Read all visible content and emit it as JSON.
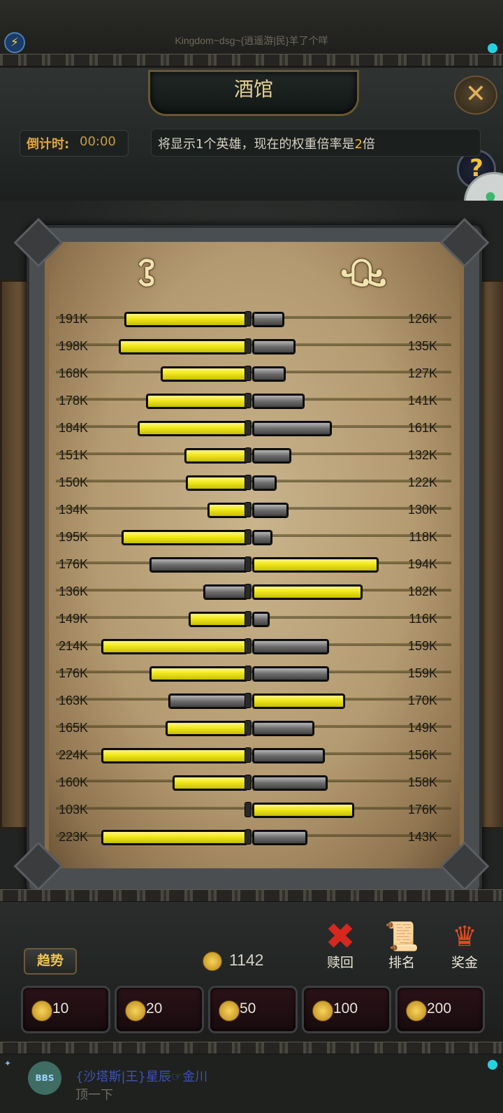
{
  "status": {
    "title": "Kingdom~dsg~{逍遥游|民}羊了个咩"
  },
  "header": {
    "title": "酒馆",
    "countdown_label": "倒计时:",
    "countdown_value": "00:00",
    "notice_prefix": "将显示1个英雄，现在的权重倍率是",
    "notice_multiplier": "2",
    "notice_suffix": "倍",
    "close_icon": "close-icon",
    "help_icon": "help-icon"
  },
  "chart_data": {
    "type": "bar",
    "series": [
      {
        "name": "",
        "values": [
          191,
          198,
          168,
          178,
          184,
          151,
          150,
          134,
          195,
          176,
          136,
          149,
          214,
          176,
          163,
          165,
          224,
          160,
          103,
          223
        ]
      },
      {
        "name": "",
        "values": [
          126,
          135,
          127,
          141,
          161,
          132,
          122,
          130,
          118,
          194,
          182,
          116,
          159,
          159,
          170,
          149,
          156,
          158,
          176,
          143
        ]
      }
    ],
    "left_labels": [
      "191K",
      "198K",
      "168K",
      "178K",
      "184K",
      "151K",
      "150K",
      "134K",
      "195K",
      "176K",
      "136K",
      "149K",
      "214K",
      "176K",
      "163K",
      "165K",
      "224K",
      "160K",
      "103K",
      "223K"
    ],
    "right_labels": [
      "126K",
      "135K",
      "127K",
      "141K",
      "161K",
      "132K",
      "122K",
      "130K",
      "118K",
      "194K",
      "182K",
      "116K",
      "159K",
      "159K",
      "170K",
      "149K",
      "156K",
      "158K",
      "176K",
      "143K"
    ],
    "left_bar": [
      0.84,
      0.88,
      0.59,
      0.69,
      0.75,
      0.43,
      0.42,
      0.27,
      0.86,
      0.67,
      0.3,
      0.4,
      1.0,
      0.67,
      0.54,
      0.56,
      1.0,
      0.51,
      0.0,
      1.0
    ],
    "right_bar": [
      0.21,
      0.29,
      0.22,
      0.35,
      0.54,
      0.26,
      0.16,
      0.24,
      0.13,
      0.86,
      0.75,
      0.11,
      0.52,
      0.52,
      0.63,
      0.42,
      0.49,
      0.51,
      0.69,
      0.37
    ],
    "winner": [
      "L",
      "L",
      "L",
      "L",
      "L",
      "L",
      "L",
      "L",
      "L",
      "R",
      "R",
      "L",
      "L",
      "L",
      "R",
      "L",
      "L",
      "L",
      "R",
      "L"
    ]
  },
  "runes": {
    "left": "ꕘ",
    "right": "ꘐ"
  },
  "bottom": {
    "trend_label": "趋势",
    "coins": "1142",
    "actions": [
      {
        "label": "赎回",
        "icon": "cross-icon"
      },
      {
        "label": "排名",
        "icon": "scroll-icon"
      },
      {
        "label": "奖金",
        "icon": "treasure-icon"
      }
    ],
    "bets": [
      "10",
      "20",
      "50",
      "100",
      "200"
    ]
  },
  "chat": {
    "user": "{沙塔斯|王}星辰☞金川",
    "message": "顶一下",
    "badge": "BBS"
  }
}
